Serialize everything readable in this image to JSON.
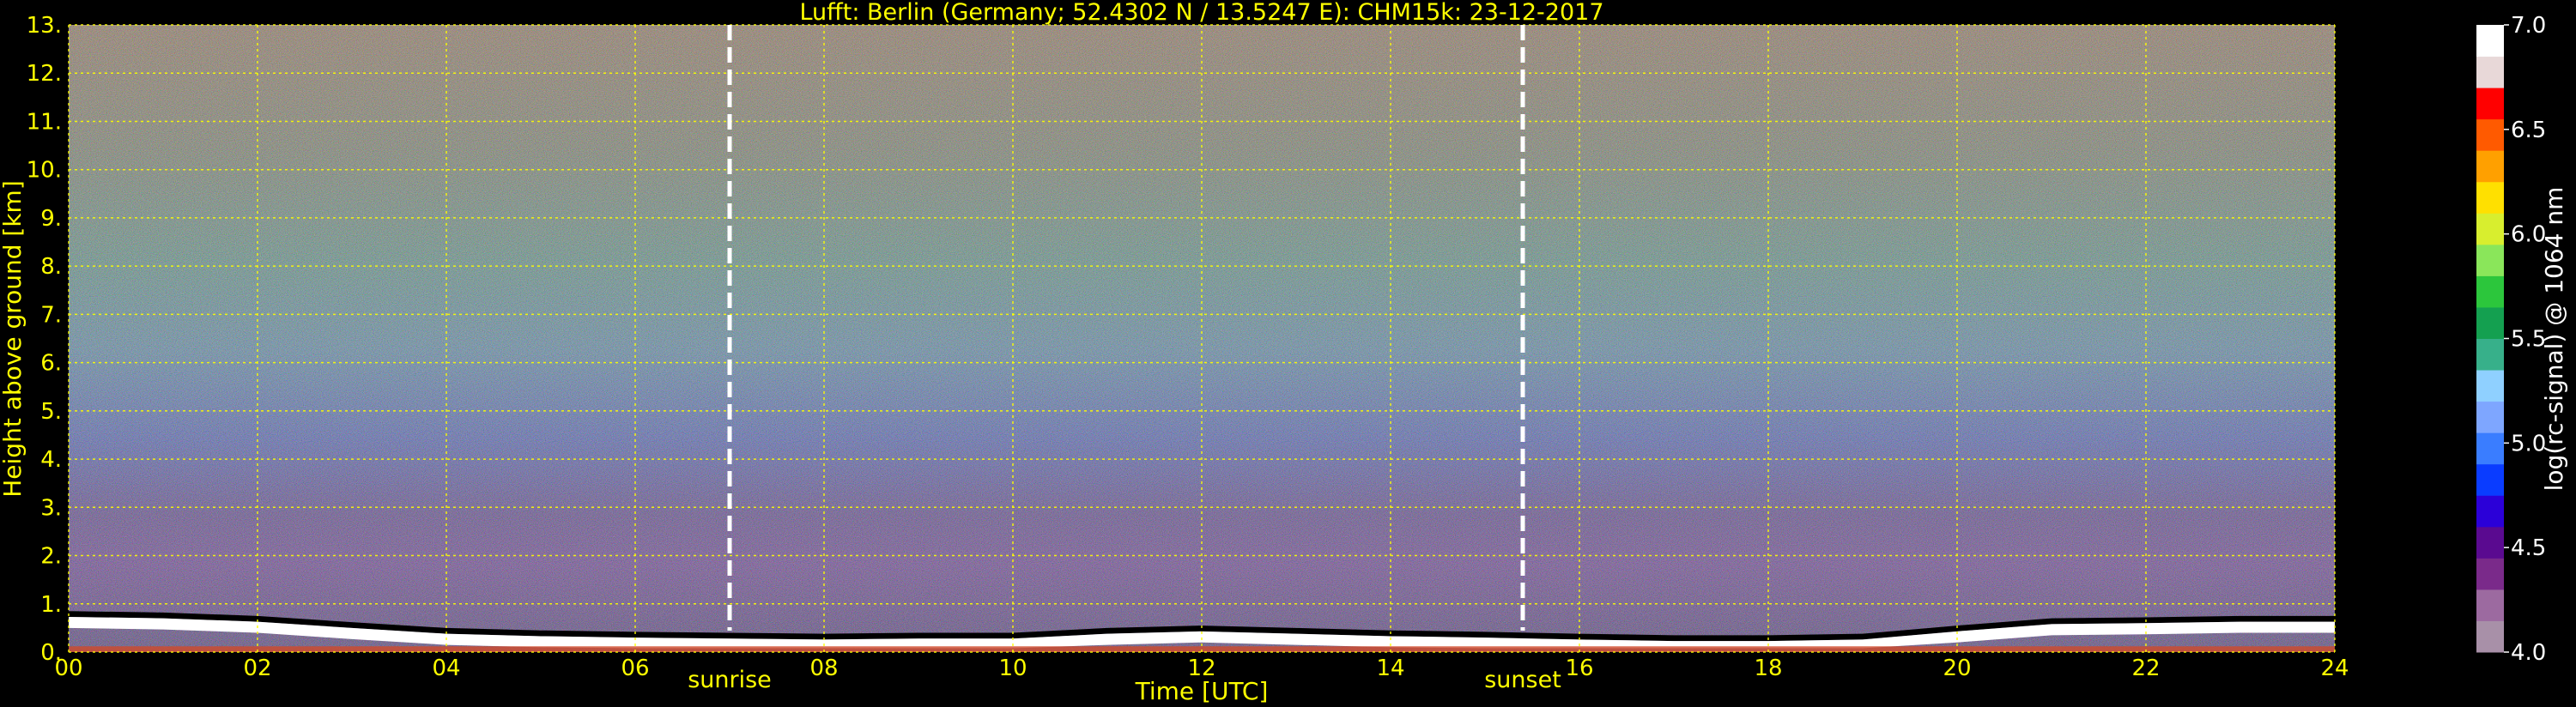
{
  "chart_data": {
    "type": "heatmap",
    "title": "Lufft: Berlin (Germany; 52.4302 N / 13.5247 E):    CHM15k: 23-12-2017",
    "xlabel": "Time [UTC]",
    "ylabel": "Height above ground [km]",
    "xlim": [
      0,
      24
    ],
    "ylim": [
      0,
      13
    ],
    "x_ticks": [
      "00",
      "02",
      "04",
      "06",
      "08",
      "10",
      "12",
      "14",
      "16",
      "18",
      "20",
      "22",
      "24"
    ],
    "y_ticks": [
      "0.",
      "1.",
      "2.",
      "3.",
      "4.",
      "5.",
      "6.",
      "7.",
      "8.",
      "9.",
      "10.",
      "11.",
      "12.",
      "13."
    ],
    "grid": true,
    "grid_color": "#ffff00",
    "events": [
      {
        "label": "sunrise",
        "time": 7.0
      },
      {
        "label": "sunset",
        "time": 15.4
      }
    ],
    "boundary_layer_top_km": [
      [
        0.0,
        0.85
      ],
      [
        1.0,
        0.82
      ],
      [
        2.0,
        0.75
      ],
      [
        3.0,
        0.62
      ],
      [
        4.0,
        0.5
      ],
      [
        5.0,
        0.45
      ],
      [
        6.0,
        0.42
      ],
      [
        7.0,
        0.4
      ],
      [
        8.0,
        0.38
      ],
      [
        9.0,
        0.4
      ],
      [
        10.0,
        0.4
      ],
      [
        11.0,
        0.5
      ],
      [
        12.0,
        0.55
      ],
      [
        13.0,
        0.5
      ],
      [
        14.0,
        0.45
      ],
      [
        15.0,
        0.42
      ],
      [
        16.0,
        0.38
      ],
      [
        17.0,
        0.35
      ],
      [
        18.0,
        0.35
      ],
      [
        19.0,
        0.38
      ],
      [
        20.0,
        0.55
      ],
      [
        21.0,
        0.7
      ],
      [
        22.0,
        0.72
      ],
      [
        23.0,
        0.75
      ],
      [
        24.0,
        0.75
      ]
    ],
    "colorbar": {
      "label": "log(rc-signal) @ 1064 nm",
      "range": [
        4.0,
        7.0
      ],
      "ticks": [
        "4.0",
        "4.5",
        "5.0",
        "5.5",
        "6.0",
        "6.5",
        "7.0"
      ],
      "colors": [
        "#a890a8",
        "#9c6aa0",
        "#7a2a8a",
        "#5a0a90",
        "#2b00d8",
        "#0a3cff",
        "#3a7dff",
        "#7ea6ff",
        "#8fd0ff",
        "#37b08a",
        "#14a050",
        "#2cc63c",
        "#8ae65a",
        "#d8ee2e",
        "#ffe000",
        "#ffa000",
        "#ff5a00",
        "#ff0000",
        "#e8d8d8",
        "#ffffff"
      ]
    }
  }
}
